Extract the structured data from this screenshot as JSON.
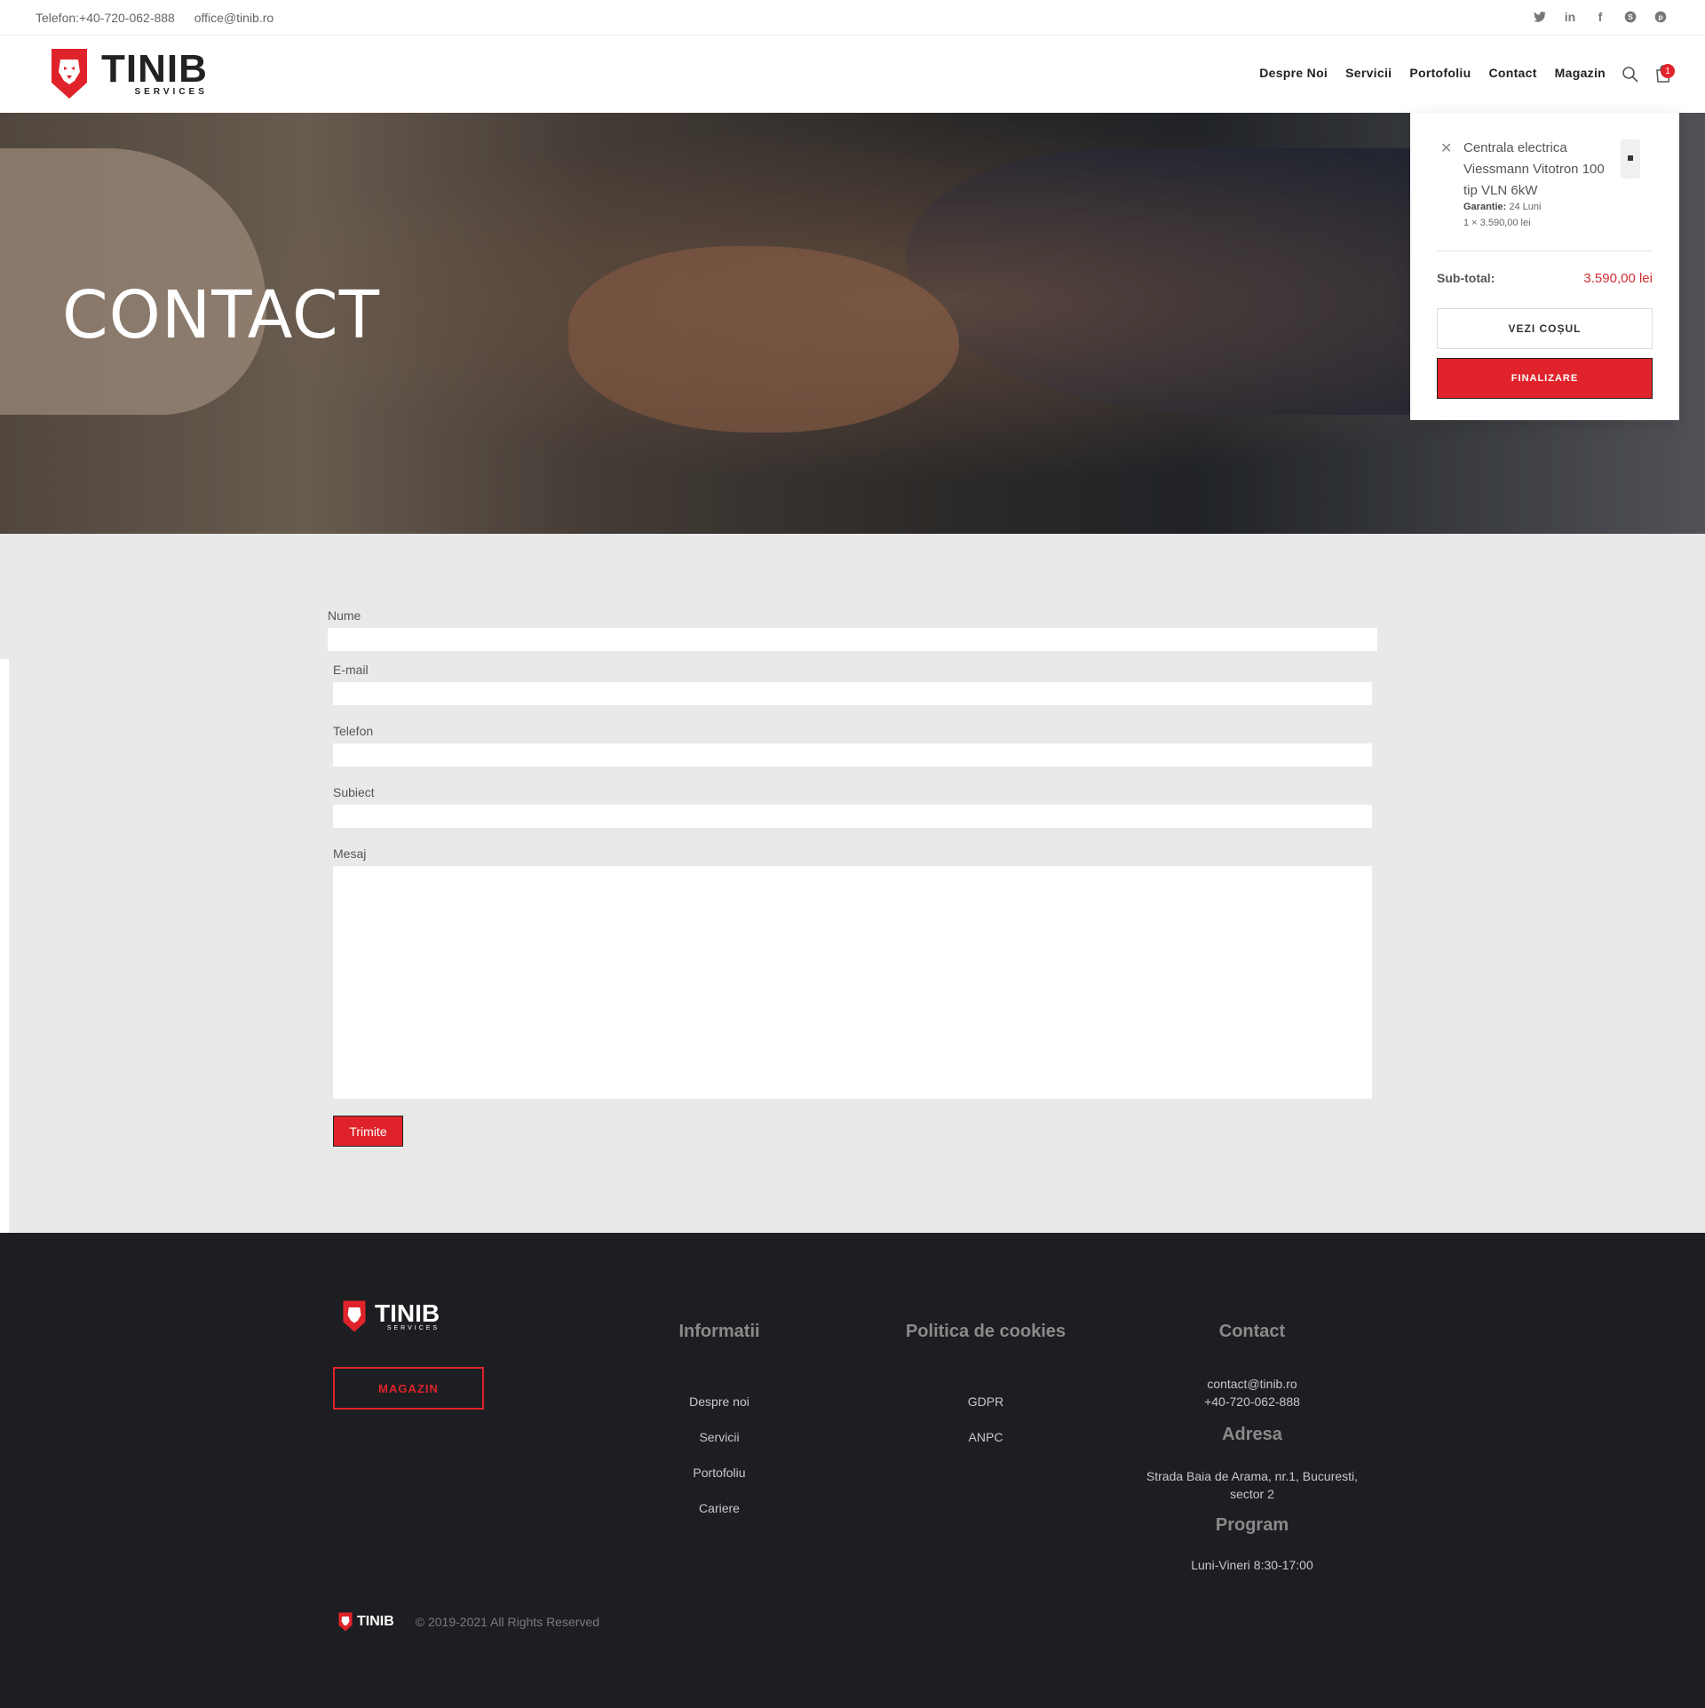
{
  "topbar": {
    "phone": "Telefon:+40-720-062-888",
    "email": "office@tinib.ro",
    "social": [
      "twitter-icon",
      "linkedin-icon",
      "facebook-icon",
      "skype-icon",
      "pinterest-icon"
    ]
  },
  "brand": {
    "name": "TINIB",
    "tagline": "SERVICES",
    "accent": "#e0232a"
  },
  "nav": [
    "Despre Noi",
    "Servicii",
    "Portofoliu",
    "Contact",
    "Magazin"
  ],
  "cart": {
    "count": "1"
  },
  "hero": {
    "title": "CONTACT"
  },
  "minicart": {
    "product": "Centrala electrica Viessmann Vitotron 100 tip VLN 6kW",
    "warranty_label": "Garantie:",
    "warranty_value": "24 Luni",
    "qty_price": "1 × 3.590,00 lei",
    "subtotal_label": "Sub-total:",
    "subtotal_value": "3.590,00 lei",
    "view_cart": "VEZI COȘUL",
    "checkout": "FINALIZARE"
  },
  "form": {
    "name_label": "Nume",
    "email_label": "E-mail",
    "phone_label": "Telefon",
    "subject_label": "Subiect",
    "message_label": "Mesaj",
    "submit": "Trimite"
  },
  "footer": {
    "shop_button": "MAGAZIN",
    "info_title": "Informatii",
    "info_links": [
      "Despre noi",
      "Servicii",
      "Portofoliu",
      "Cariere"
    ],
    "cookies_title": "Politica de cookies",
    "cookies_links": [
      "GDPR",
      "ANPC"
    ],
    "contact_title": "Contact",
    "contact_email": "contact@tinib.ro",
    "contact_phone": "+40-720-062-888",
    "address_title": "Adresa",
    "address": "Strada Baia de Arama, nr.1, Bucuresti, sector 2",
    "program_title": "Program",
    "program": "Luni-Vineri 8:30-17:00",
    "copyright": "© 2019-2021 All Rights Reserved"
  }
}
